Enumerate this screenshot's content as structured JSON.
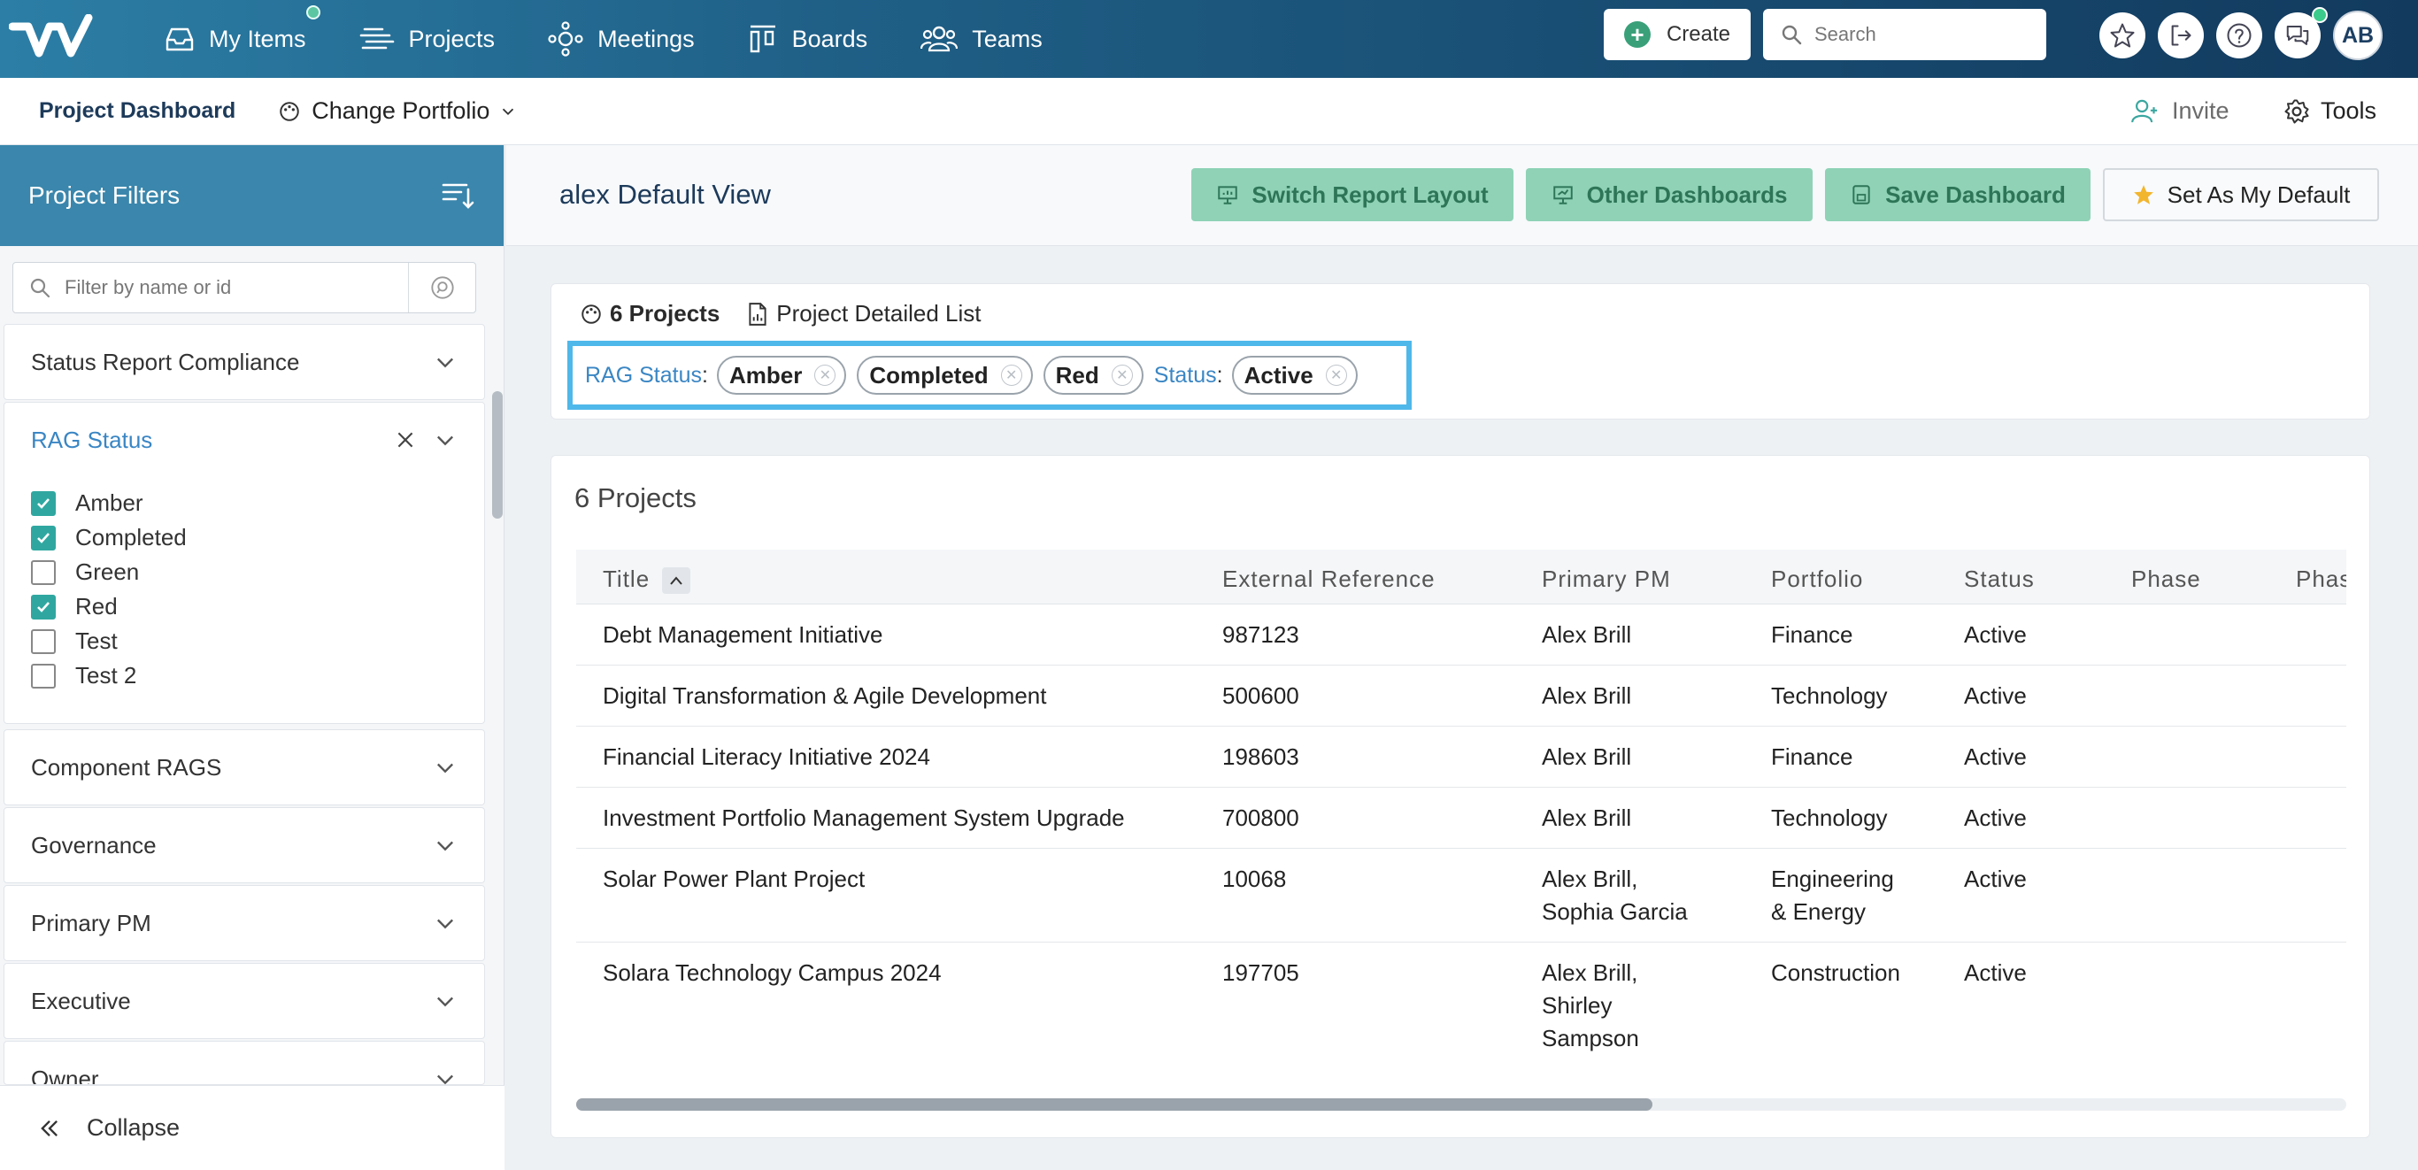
{
  "topnav": {
    "items": [
      {
        "label": "My Items",
        "icon": "inbox-icon"
      },
      {
        "label": "Projects",
        "icon": "projects-icon"
      },
      {
        "label": "Meetings",
        "icon": "meetings-icon"
      },
      {
        "label": "Boards",
        "icon": "boards-icon"
      },
      {
        "label": "Teams",
        "icon": "teams-icon"
      }
    ],
    "create_label": "Create",
    "search_placeholder": "Search",
    "avatar_initials": "AB"
  },
  "subnav": {
    "title": "Project Dashboard",
    "portfolio_label": "Change Portfolio",
    "invite_label": "Invite",
    "tools_label": "Tools"
  },
  "sidebar": {
    "header": "Project Filters",
    "search_placeholder": "Filter by name or id",
    "sections": {
      "status_report": "Status Report Compliance",
      "rag_status": "RAG Status",
      "component_rags": "Component RAGS",
      "governance": "Governance",
      "primary_pm": "Primary PM",
      "executive": "Executive",
      "owner": "Owner"
    },
    "rag_options": [
      {
        "label": "Amber",
        "checked": true
      },
      {
        "label": "Completed",
        "checked": true
      },
      {
        "label": "Green",
        "checked": false
      },
      {
        "label": "Red",
        "checked": true
      },
      {
        "label": "Test",
        "checked": false
      },
      {
        "label": "Test 2",
        "checked": false
      }
    ],
    "collapse_label": "Collapse"
  },
  "header": {
    "view_title": "alex Default View",
    "switch_layout": "Switch Report Layout",
    "other_dashboards": "Other Dashboards",
    "save_dashboard": "Save Dashboard",
    "set_default": "Set As My Default"
  },
  "summary": {
    "projects_tab": "6 Projects",
    "detail_tab": "Project Detailed List",
    "filter_rag_label": "RAG Status",
    "filter_status_label": "Status",
    "rag_chips": [
      "Amber",
      "Completed",
      "Red"
    ],
    "status_chips": [
      "Active"
    ]
  },
  "table": {
    "title": "6 Projects",
    "columns": [
      "Title",
      "External Reference",
      "Primary PM",
      "Portfolio",
      "Status",
      "Phase",
      "Phas"
    ],
    "rows": [
      {
        "title": "Debt Management Initiative",
        "ref": "987123",
        "pm": "Alex Brill",
        "portfolio": "Finance",
        "status": "Active"
      },
      {
        "title": "Digital Transformation & Agile Development",
        "ref": "500600",
        "pm": "Alex Brill",
        "portfolio": "Technology",
        "status": "Active"
      },
      {
        "title": "Financial Literacy Initiative 2024",
        "ref": "198603",
        "pm": "Alex Brill",
        "portfolio": "Finance",
        "status": "Active"
      },
      {
        "title": "Investment Portfolio Management System Upgrade",
        "ref": "700800",
        "pm": "Alex Brill",
        "portfolio": "Technology",
        "status": "Active"
      },
      {
        "title": "Solar Power Plant Project",
        "ref": "10068",
        "pm": "Alex Brill,\nSophia Garcia",
        "portfolio": "Engineering\n& Energy",
        "status": "Active"
      },
      {
        "title": "Solara Technology Campus 2024",
        "ref": "197705",
        "pm": "Alex Brill,\nShirley\nSampson",
        "portfolio": "Construction",
        "status": "Active"
      }
    ]
  },
  "colors": {
    "accent_blue": "#3a86ac",
    "button_green": "#8fd2b6",
    "highlight_border": "#4fb8ea",
    "check_teal": "#2fa7a0"
  }
}
